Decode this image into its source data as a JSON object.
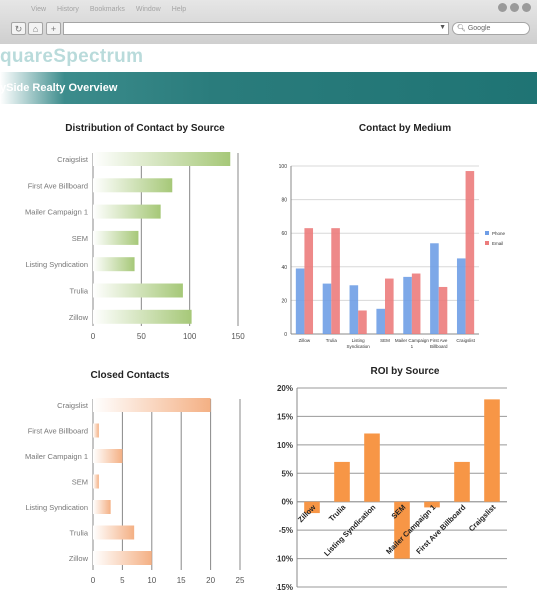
{
  "browser": {
    "menu": [
      "View",
      "History",
      "Bookmarks",
      "Window",
      "Help"
    ],
    "tool_add": "+",
    "search_placeholder": "Google",
    "colors": {
      "chrome": "#d9d9d9"
    }
  },
  "site": {
    "logo": "quareSpectrum",
    "banner": "ySide Realty Overview",
    "colors": {
      "banner": "#227878",
      "logo": "#3a9b9b"
    }
  },
  "chart_data": [
    {
      "type": "bar",
      "orientation": "horizontal",
      "title": "Distribution of Contact by Source",
      "categories": [
        "Craigslist",
        "First Ave Billboard",
        "Mailer Campaign 1",
        "SEM",
        "Listing Syndication",
        "Trulia",
        "Zillow"
      ],
      "values": [
        142,
        82,
        70,
        47,
        43,
        93,
        102
      ],
      "xlim": [
        0,
        150
      ],
      "xticks": [
        "0",
        "50",
        "100",
        "150"
      ],
      "bar_color": "#a6c878"
    },
    {
      "type": "bar",
      "title": "Contact by Medium",
      "categories": [
        "Zillow",
        "Trulia",
        "Listing Syndication",
        "SEM",
        "Mailer Campaign 1",
        "First Ave Billboard",
        "Craigslist"
      ],
      "series": [
        {
          "name": "Phone",
          "values": [
            39,
            30,
            29,
            15,
            34,
            54,
            45
          ],
          "color": "#6f9ee6"
        },
        {
          "name": "Email",
          "values": [
            63,
            63,
            14,
            33,
            36,
            28,
            97
          ],
          "color": "#ec7c7c"
        }
      ],
      "ylim": [
        0,
        100
      ],
      "yticks": [
        "0",
        "20",
        "40",
        "60",
        "80",
        "100"
      ],
      "legend": "right"
    },
    {
      "type": "bar",
      "orientation": "horizontal",
      "title": "Closed Contacts",
      "categories": [
        "Craigslist",
        "First Ave Billboard",
        "Mailer Campaign 1",
        "SEM",
        "Listing Syndication",
        "Trulia",
        "Zillow"
      ],
      "values": [
        20,
        1,
        5,
        1,
        3,
        7,
        10
      ],
      "xlim": [
        0,
        25
      ],
      "xticks": [
        "0",
        "5",
        "10",
        "15",
        "20",
        "25"
      ],
      "bar_color": "#f4b084"
    },
    {
      "type": "bar",
      "title": "ROI by Source",
      "categories": [
        "Zillow",
        "Trulia",
        "Listing Syndication",
        "SEM",
        "Mailer Campaign 1",
        "First Ave Billboard",
        "Craigslist"
      ],
      "values": [
        -2,
        7,
        12,
        -10,
        -1,
        7,
        18
      ],
      "ylim": [
        -15,
        20
      ],
      "yticks": [
        "-15%",
        "-10%",
        "-5%",
        "0%",
        "5%",
        "10%",
        "15%",
        "20%"
      ],
      "bar_color": "#f79646"
    }
  ]
}
